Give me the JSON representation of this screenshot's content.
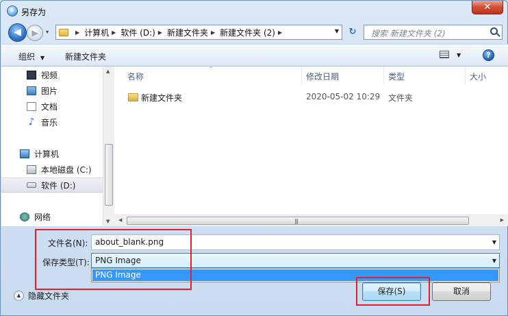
{
  "window": {
    "title": "另存为",
    "close_glyph": "✕"
  },
  "nav": {
    "back_glyph": "◀",
    "forward_glyph": "▶",
    "recent_glyph": "▾"
  },
  "address": {
    "crumbs": [
      "计算机",
      "软件 (D:)",
      "新建文件夹",
      "新建文件夹 (2)"
    ],
    "separator": "▶",
    "dropdown_glyph": "▼",
    "refresh_glyph": "↻"
  },
  "search": {
    "placeholder": "搜索 新建文件夹 (2)",
    "icon": "search-icon"
  },
  "toolbar": {
    "organize_label": "组织",
    "organize_arrow": "▼",
    "new_folder_label": "新建文件夹",
    "view_arrow": "▼",
    "help_glyph": "?"
  },
  "sidebar": {
    "items": [
      {
        "label": "视频",
        "icon": "video-icon"
      },
      {
        "label": "图片",
        "icon": "picture-icon"
      },
      {
        "label": "文档",
        "icon": "document-icon"
      },
      {
        "label": "音乐",
        "icon": "music-icon"
      },
      {
        "label": "计算机",
        "icon": "computer-icon"
      },
      {
        "label": "本地磁盘 (C:)",
        "icon": "drive-icon"
      },
      {
        "label": "软件 (D:)",
        "icon": "drive-icon",
        "selected": true
      },
      {
        "label": "网络",
        "icon": "network-icon"
      }
    ],
    "scroll_up": "▲",
    "scroll_down": "▼"
  },
  "filelist": {
    "columns": [
      "名称",
      "修改日期",
      "类型",
      "大小"
    ],
    "sort_caret": "^",
    "rows": [
      {
        "name": "新建文件夹",
        "modified": "2020-05-02 10:29",
        "type": "文件夹",
        "size": ""
      }
    ],
    "hscroll_left": "◀",
    "hscroll_right": "▶",
    "hscroll_grip": "|||"
  },
  "form": {
    "filename_label": "文件名(N):",
    "filename_value": "about_blank.png",
    "filename_drop": "▼",
    "filetype_label": "保存类型(T):",
    "filetype_value": "PNG Image",
    "filetype_drop": "▼",
    "filetype_options": [
      "PNG Image"
    ]
  },
  "footer": {
    "hide_folders_label": "隐藏文件夹",
    "hide_folders_glyph": "▲",
    "save_label": "保存(S)",
    "cancel_label": "取消"
  },
  "colors": {
    "annotation": "#e0202a",
    "selection": "#3399ff",
    "close_button": "#c8381f"
  }
}
